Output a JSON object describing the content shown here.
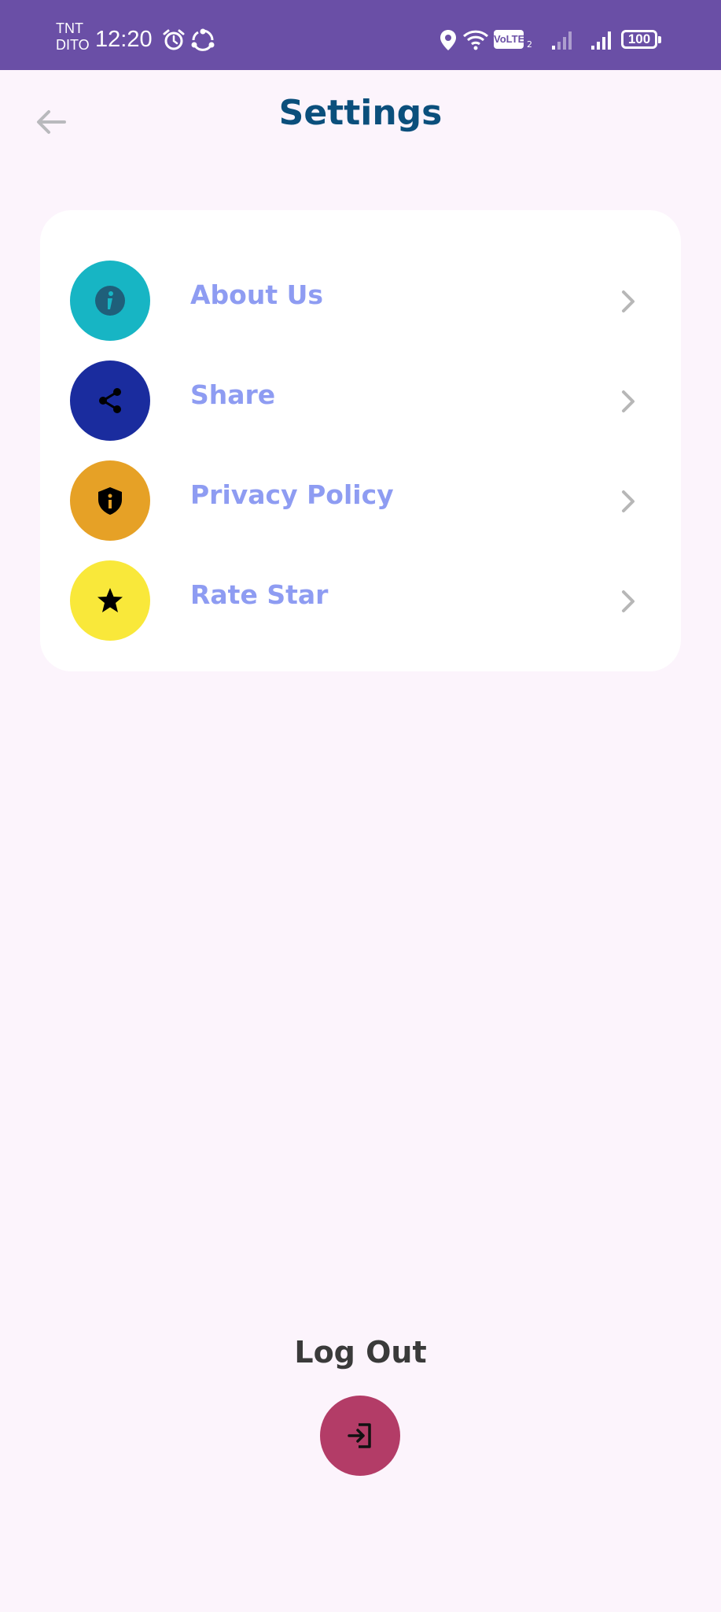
{
  "status_bar": {
    "carrier_top": "TNT",
    "carrier_bottom": "DITO",
    "time": "12:20",
    "volte": "VoLTE",
    "volte_sub": "2",
    "battery": "100",
    "icons": [
      "alarm-icon",
      "sync-icon",
      "location-icon",
      "wifi-icon",
      "volte-icon",
      "signal-weak-icon",
      "signal-icon",
      "battery-icon"
    ],
    "background": "#6a4fa6"
  },
  "header": {
    "title": "Settings",
    "back_icon": "arrow-left-icon"
  },
  "settings": {
    "items": [
      {
        "label": "About Us",
        "icon": "info-icon",
        "color": "#17b5c4"
      },
      {
        "label": "Share",
        "icon": "share-icon",
        "color": "#1a2c9e"
      },
      {
        "label": "Privacy Policy",
        "icon": "shield-icon",
        "color": "#e6a126"
      },
      {
        "label": "Rate Star",
        "icon": "star-icon",
        "color": "#f9e83a"
      }
    ],
    "chevron_icon": "chevron-right-icon"
  },
  "logout": {
    "label": "Log Out",
    "icon": "logout-icon",
    "color": "#b33c67"
  },
  "colors": {
    "background": "#fcf4fc",
    "title": "#0b4f7c",
    "item_label": "#8e9cf2"
  }
}
